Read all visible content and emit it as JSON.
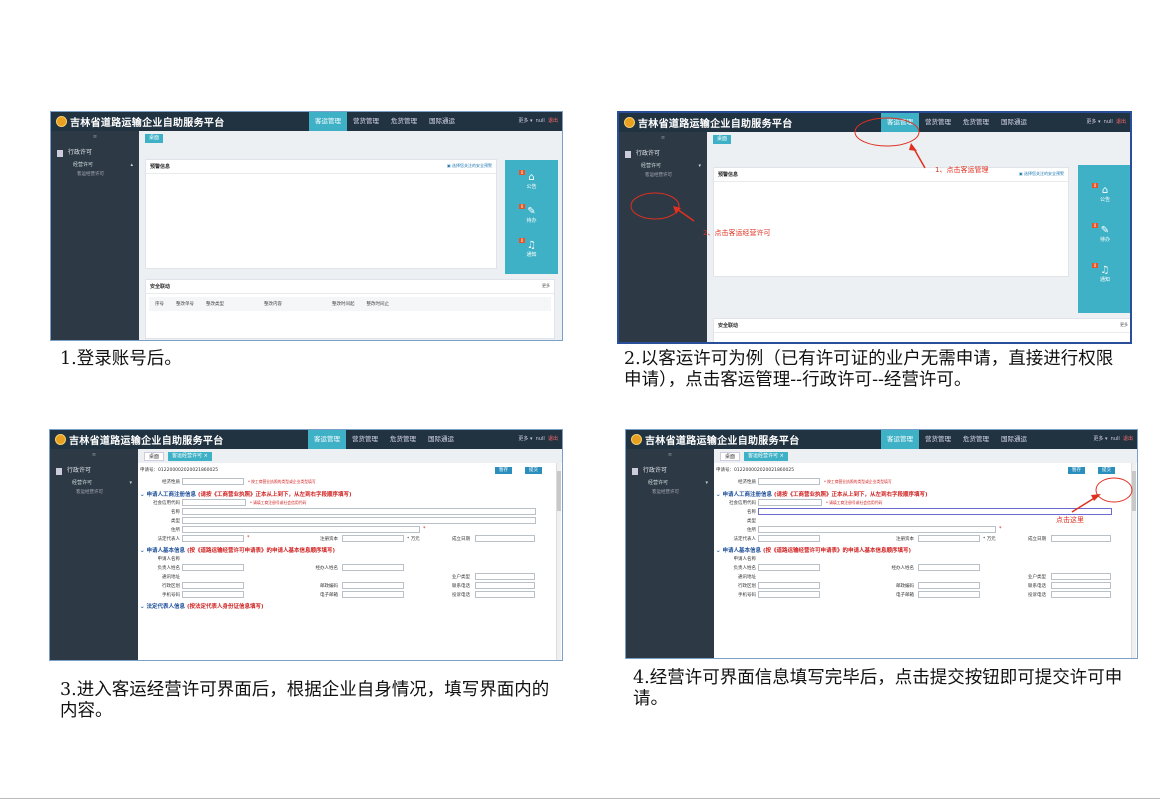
{
  "app": {
    "title": "吉林省道路运输企业自助服务平台",
    "nav": [
      "客运管理",
      "营货管理",
      "危货管理",
      "国际通运"
    ],
    "more": "更多 ▾",
    "user": "null",
    "logout": "退出",
    "sidebar_toggle": "≡",
    "menu_admin": "行政许可",
    "menu_license": "经营许可",
    "menu_passenger_license": "客运经营许可"
  },
  "dashboard": {
    "tab_home": "桌面",
    "warning_title": "预警信息",
    "warning_link": "选择您关注的安全预警",
    "safety_title": "安全联动",
    "more": "更多",
    "cols": [
      "序号",
      "整改单号",
      "整改类型",
      "整改内容",
      "整改时间起",
      "整改时间止"
    ],
    "teal": [
      {
        "badge": "0",
        "icon": "⌂",
        "label": "公告"
      },
      {
        "badge": "0",
        "icon": "✎",
        "label": "待办"
      },
      {
        "badge": "0",
        "icon": "♫",
        "label": "通知"
      }
    ]
  },
  "form": {
    "tab_home": "桌面",
    "tab_form": "客运经营许可 ×",
    "apply_no": "申请号：012200002020021860025",
    "save": "暂存",
    "submit": "提交",
    "f_type": "经济性质",
    "hint_type": "* 按工商营业执照的类型或企业类型填写",
    "sec1_pre": "申请人工商注册信息",
    "sec1_red": "(请按《工商营业执照》正本从上到下，从左到右字段顺序填写)",
    "f_code": "社会信用代码",
    "hint_code": "* 请填工商注册号或社会信用代码",
    "f_name": "名称",
    "f_kind": "类型",
    "f_addr": "住所",
    "f_legal": "法定代表人",
    "f_capital": "注册资本",
    "f_unit": "万元",
    "f_date": "成立日期",
    "sec2_pre": "申请人基本信息",
    "sec2_red": "(按《道路运输经营许可申请表》的申请人基本信息顺序填写)",
    "f_applicant": "申请人名称",
    "f_person": "负责人姓名",
    "f_agent": "经办人姓名",
    "f_comm": "通讯地址",
    "f_biz": "业户类型",
    "f_region": "行政区划",
    "f_zip": "邮政编码",
    "f_tel": "联系电话",
    "f_phone": "手机号码",
    "f_email": "电子邮箱",
    "f_complaint": "投诉电话",
    "sec3_pre": "法定代表人信息",
    "sec3_red": "(按法定代表人身份证信息填写)"
  },
  "annotations": {
    "a1": "1、点击客运管理",
    "a2": "2、点击客运经营许可",
    "a4": "点击这里"
  },
  "captions": {
    "c1": "1.登录账号后。",
    "c2": "2.以客运许可为例（已有许可证的业户无需申请，直接进行权限申请），点击客运管理--行政许可--经营许可。",
    "c3": "3.进入客运经营许可界面后，根据企业自身情况，填写界面内的内容。",
    "c4": "4.经营许可界面信息填写完毕后，点击提交按钮即可提交许可申请。"
  }
}
